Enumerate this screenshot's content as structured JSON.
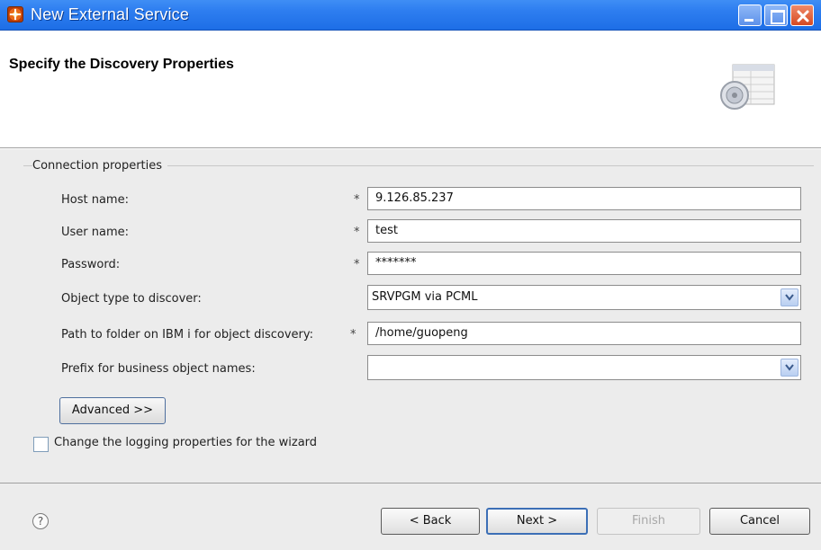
{
  "window": {
    "title": "New External Service"
  },
  "header": {
    "title": "Specify the Discovery Properties"
  },
  "connection": {
    "group_label": "Connection properties",
    "required_marker": "*",
    "fields": [
      {
        "label": "Host name:",
        "value": "9.126.85.237"
      },
      {
        "label": "User name:",
        "value": "test"
      },
      {
        "label": "Password:",
        "value": "*******"
      },
      {
        "label": "Object type to discover:",
        "value": "SRVPGM via PCML"
      },
      {
        "label": "Path to folder on IBM i for object discovery:",
        "value": "/home/guopeng"
      },
      {
        "label": "Prefix for business object names:",
        "value": ""
      }
    ]
  },
  "advanced_button": "Advanced >>",
  "logging_checkbox": {
    "label": "Change the logging properties for the wizard",
    "checked": false
  },
  "footer": {
    "help": "?",
    "back": "< Back",
    "next": "Next >",
    "finish": "Finish",
    "cancel": "Cancel"
  }
}
